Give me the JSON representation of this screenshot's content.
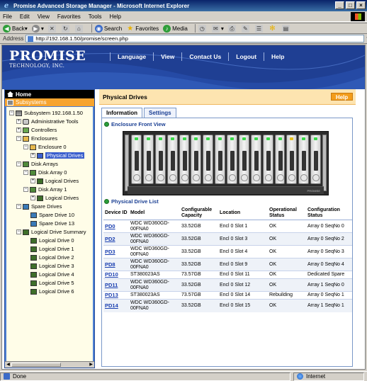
{
  "window": {
    "title": "Promise Advanced Storage Manager - Microsoft Internet Explorer"
  },
  "menu": [
    "File",
    "Edit",
    "View",
    "Favorites",
    "Tools",
    "Help"
  ],
  "toolbar": {
    "back": "Back",
    "search": "Search",
    "favorites": "Favorites",
    "media": "Media"
  },
  "address": {
    "label": "Address",
    "url": "http://192.168.1.50/promise/screen.php"
  },
  "banner": {
    "logo_main": "PROMISE",
    "logo_sub": "TECHNOLOGY, INC.",
    "nav": [
      "Language",
      "View",
      "Contact Us",
      "Logout",
      "Help"
    ]
  },
  "tree": {
    "home": "Home",
    "subsystems": "Subsystems",
    "nodes": [
      "Subsystem 192.168.1.50",
      "Administrative Tools",
      "Controllers",
      "Enclosures",
      "Enclosure 0",
      "Physical Drives",
      "Disk Arrays",
      "Disk Array 0",
      "Logical Drives",
      "Disk Array 1",
      "Logical Drives",
      "Spare Drives",
      "Spare Drive 10",
      "Spare Drive 13",
      "Logical Drive Summary",
      "Logical Drive 0",
      "Logical Drive 1",
      "Logical Drive 2",
      "Logical Drive 3",
      "Logical Drive 4",
      "Logical Drive 5",
      "Logical Drive 6"
    ]
  },
  "main": {
    "title": "Physical Drives",
    "help": "Help",
    "tabs": [
      "Information",
      "Settings"
    ],
    "enclosure_label": "Enclosure Front View",
    "list_label": "Physical Drive List",
    "columns": [
      "Device ID",
      "Model",
      "Configurable Capacity",
      "Location",
      "Operational Status",
      "Configuration Status"
    ],
    "rows": [
      [
        "PD0",
        "WDC WD360GD-00FNA0",
        "33.52GB",
        "Encl 0 Slot 1",
        "OK",
        "Array 0 SeqNo 0"
      ],
      [
        "PD2",
        "WDC WD360GD-00FNA0",
        "33.52GB",
        "Encl 0 Slot 3",
        "OK",
        "Array 0 SeqNo 2"
      ],
      [
        "PD3",
        "WDC WD360GD-00FNA0",
        "33.52GB",
        "Encl 0 Slot 4",
        "OK",
        "Array 0 SeqNo 3"
      ],
      [
        "PD8",
        "WDC WD360GD-00FNA0",
        "33.52GB",
        "Encl 0 Slot 9",
        "OK",
        "Array 0 SeqNo 4"
      ],
      [
        "PD10",
        "ST380023AS",
        "73.57GB",
        "Encl 0 Slot 11",
        "OK",
        "Dedicated Spare"
      ],
      [
        "PD11",
        "WDC WD360GD-00FNA0",
        "33.52GB",
        "Encl 0 Slot 12",
        "OK",
        "Array 1 SeqNo 0"
      ],
      [
        "PD13",
        "ST380023AS",
        "73.57GB",
        "Encl 0 Slot 14",
        "Rebuilding",
        "Array 0 SeqNo 1"
      ],
      [
        "PD14",
        "WDC WD360GD-00FNA0",
        "33.52GB",
        "Encl 0 Slot 15",
        "OK",
        "Array 1 SeqNo 1"
      ]
    ]
  },
  "status": {
    "left": "Done",
    "zone": "Internet"
  },
  "colors": {
    "banner": "#1f3f93",
    "tree": "#4b7ed3",
    "subsystems": "#f7a42f",
    "header": "#fde4b0",
    "help": "#f39c1a",
    "link": "#1a3fb0"
  }
}
